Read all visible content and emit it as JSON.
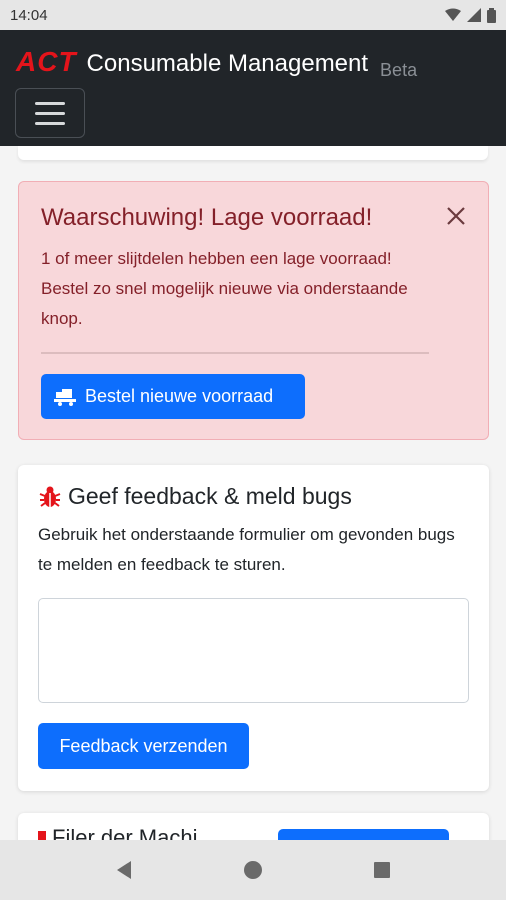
{
  "status_bar": {
    "time": "14:04"
  },
  "header": {
    "logo": "ACT",
    "title": "Consumable Management",
    "badge": "Beta"
  },
  "alert": {
    "title": "Waarschuwing! Lage voorraad!",
    "text": "1 of meer slijtdelen hebben een lage voorraad! Bestel zo snel mogelijk nieuwe via onderstaande knop.",
    "button_label": "Bestel nieuwe voorraad"
  },
  "feedback": {
    "title": "Geef feedback & meld bugs",
    "text": "Gebruik het onderstaande formulier om gevonden bugs te melden en feedback te sturen.",
    "textarea_value": "",
    "button_label": "Feedback verzenden"
  },
  "next_card": {
    "title": "Filer der Machi"
  },
  "colors": {
    "primary": "#0d6efd",
    "brand_red": "#e4141b",
    "alert_bg": "#f8d7da",
    "alert_text": "#842029",
    "header_bg": "#212529"
  },
  "icons": [
    "wifi-icon",
    "signal-icon",
    "battery-icon",
    "close-icon",
    "truck-icon",
    "bug-icon",
    "back-icon",
    "home-icon",
    "recents-icon"
  ]
}
